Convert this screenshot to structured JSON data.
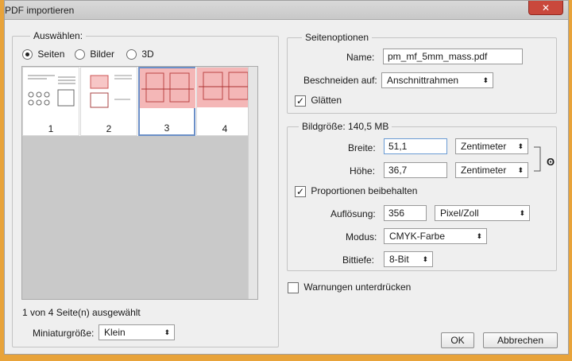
{
  "window": {
    "title": "PDF importieren",
    "close": "✕"
  },
  "left": {
    "group_title": "Auswählen:",
    "radios": [
      {
        "label": "Seiten",
        "checked": true
      },
      {
        "label": "Bilder",
        "checked": false
      },
      {
        "label": "3D",
        "checked": false
      }
    ],
    "thumbnails": [
      {
        "num": "1",
        "selected": false
      },
      {
        "num": "2",
        "selected": false
      },
      {
        "num": "3",
        "selected": true
      },
      {
        "num": "4",
        "selected": false
      }
    ],
    "status": "1 von 4 Seite(n) ausgewählt",
    "thumb_size_label": "Miniaturgröße:",
    "thumb_size_value": "Klein"
  },
  "page_options": {
    "group_title": "Seitenoptionen",
    "name_label": "Name:",
    "name_value": "pm_mf_5mm_mass.pdf",
    "crop_label": "Beschneiden auf:",
    "crop_value": "Anschnittrahmen",
    "smooth_label": "Glätten",
    "smooth_checked": true
  },
  "image_size": {
    "group_title": "Bildgröße: 140,5 MB",
    "width_label": "Breite:",
    "width_value": "51,1",
    "width_unit": "Zentimeter",
    "height_label": "Höhe:",
    "height_value": "36,7",
    "height_unit": "Zentimeter",
    "keep_proportions_label": "Proportionen beibehalten",
    "keep_proportions_checked": true,
    "resolution_label": "Auflösung:",
    "resolution_value": "356",
    "resolution_unit": "Pixel/Zoll",
    "mode_label": "Modus:",
    "mode_value": "CMYK-Farbe",
    "depth_label": "Bittiefe:",
    "depth_value": "8-Bit"
  },
  "warnings_label": "Warnungen unterdrücken",
  "warnings_checked": false,
  "buttons": {
    "ok": "OK",
    "cancel": "Abbrechen"
  },
  "colors": {
    "accent_frame": "#e8a33a",
    "selection_border": "#6b8fc7",
    "page_highlight": "#f4b7b7"
  }
}
